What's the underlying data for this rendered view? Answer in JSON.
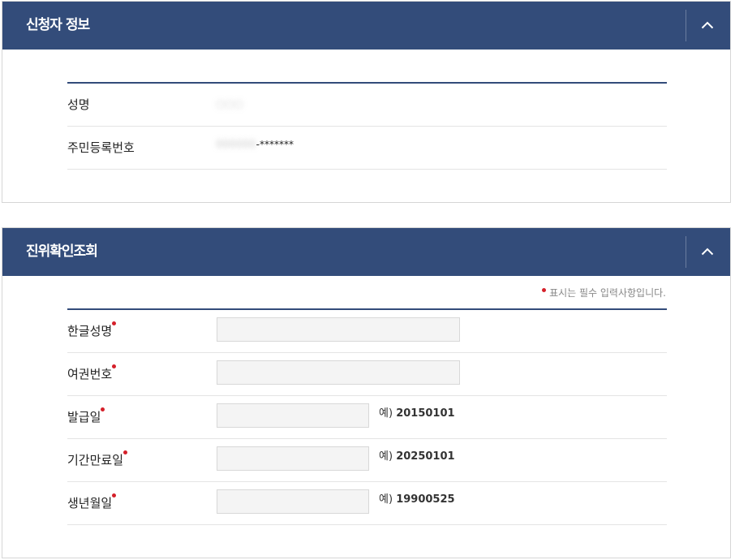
{
  "applicant_panel": {
    "title": "신청자 정보",
    "fields": {
      "name_label": "성명",
      "name_value": "○○○",
      "rrn_label": "주민등록번호",
      "rrn_front": "000000",
      "rrn_back_mask": "-*******"
    }
  },
  "verify_panel": {
    "title": "진위확인조회",
    "required_note": "표시는 필수 입력사항입니다.",
    "fields": [
      {
        "label": "한글성명",
        "hint": ""
      },
      {
        "label": "여권번호",
        "hint": ""
      },
      {
        "label": "발급일",
        "hint_prefix": "예)",
        "hint": "20150101"
      },
      {
        "label": "기간만료일",
        "hint_prefix": "예)",
        "hint": "20250101"
      },
      {
        "label": "생년월일",
        "hint_prefix": "예)",
        "hint": "19900525"
      }
    ]
  },
  "icons": {
    "toggle": "chevron-up-icon",
    "required": "required-dot-icon"
  },
  "colors": {
    "header_bg": "#334c7a",
    "required_dot": "#d5202a"
  }
}
